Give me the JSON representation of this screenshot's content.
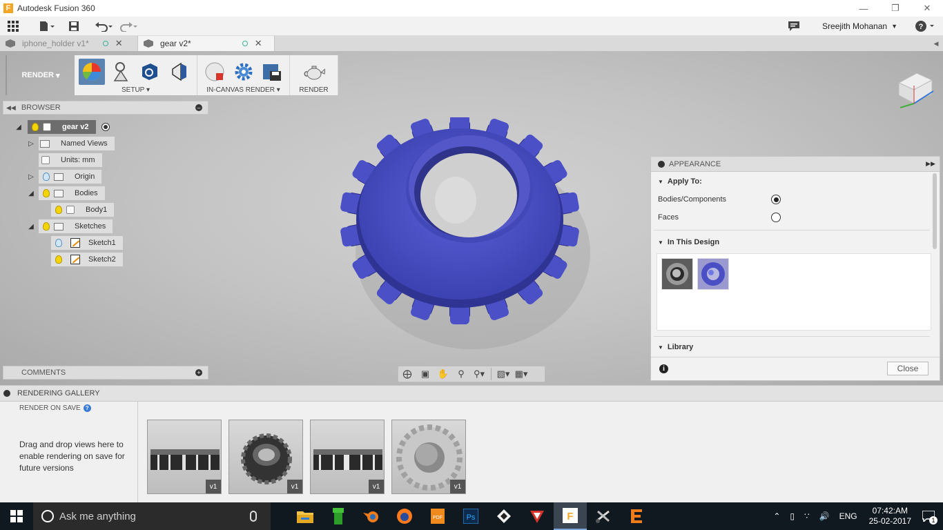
{
  "window": {
    "title": "Autodesk Fusion 360",
    "app_icon": "fusion-logo-icon"
  },
  "toolbar": {
    "user": "Sreejith Mohanan"
  },
  "tabs": [
    {
      "label": "iphone_holder v1*",
      "active": false
    },
    {
      "label": "gear v2*",
      "active": true
    }
  ],
  "ribbon": {
    "workspace": "RENDER",
    "groups": [
      {
        "label": "SETUP"
      },
      {
        "label": "IN-CANVAS RENDER"
      },
      {
        "label": "RENDER"
      }
    ]
  },
  "browser": {
    "title": "BROWSER",
    "items": [
      {
        "label": "gear v2"
      },
      {
        "label": "Named Views"
      },
      {
        "label": "Units: mm"
      },
      {
        "label": "Origin"
      },
      {
        "label": "Bodies"
      },
      {
        "label": "Body1"
      },
      {
        "label": "Sketches"
      },
      {
        "label": "Sketch1"
      },
      {
        "label": "Sketch2"
      }
    ]
  },
  "comments": {
    "title": "COMMENTS"
  },
  "appearance": {
    "title": "APPEARANCE",
    "apply_to": "Apply To:",
    "options": [
      {
        "label": "Bodies/Components",
        "selected": true
      },
      {
        "label": "Faces",
        "selected": false
      }
    ],
    "in_this_design": "In This Design",
    "library": "Library",
    "close": "Close"
  },
  "gallery": {
    "title": "RENDERING GALLERY",
    "render_on_save": "RENDER ON SAVE",
    "hint": "Drag and drop views here to enable rendering on save for future versions",
    "thumbnails": [
      {
        "version": "v1"
      },
      {
        "version": "v1"
      },
      {
        "version": "v1"
      },
      {
        "version": "v1"
      }
    ]
  },
  "taskbar": {
    "search_placeholder": "Ask me anything",
    "language": "ENG",
    "time": "07:42:AM",
    "date": "25-02-2017",
    "notifications": "1"
  },
  "colors": {
    "gear": "#4a4fc4",
    "selected": "#5b84b0",
    "accent": "#f6a623"
  }
}
